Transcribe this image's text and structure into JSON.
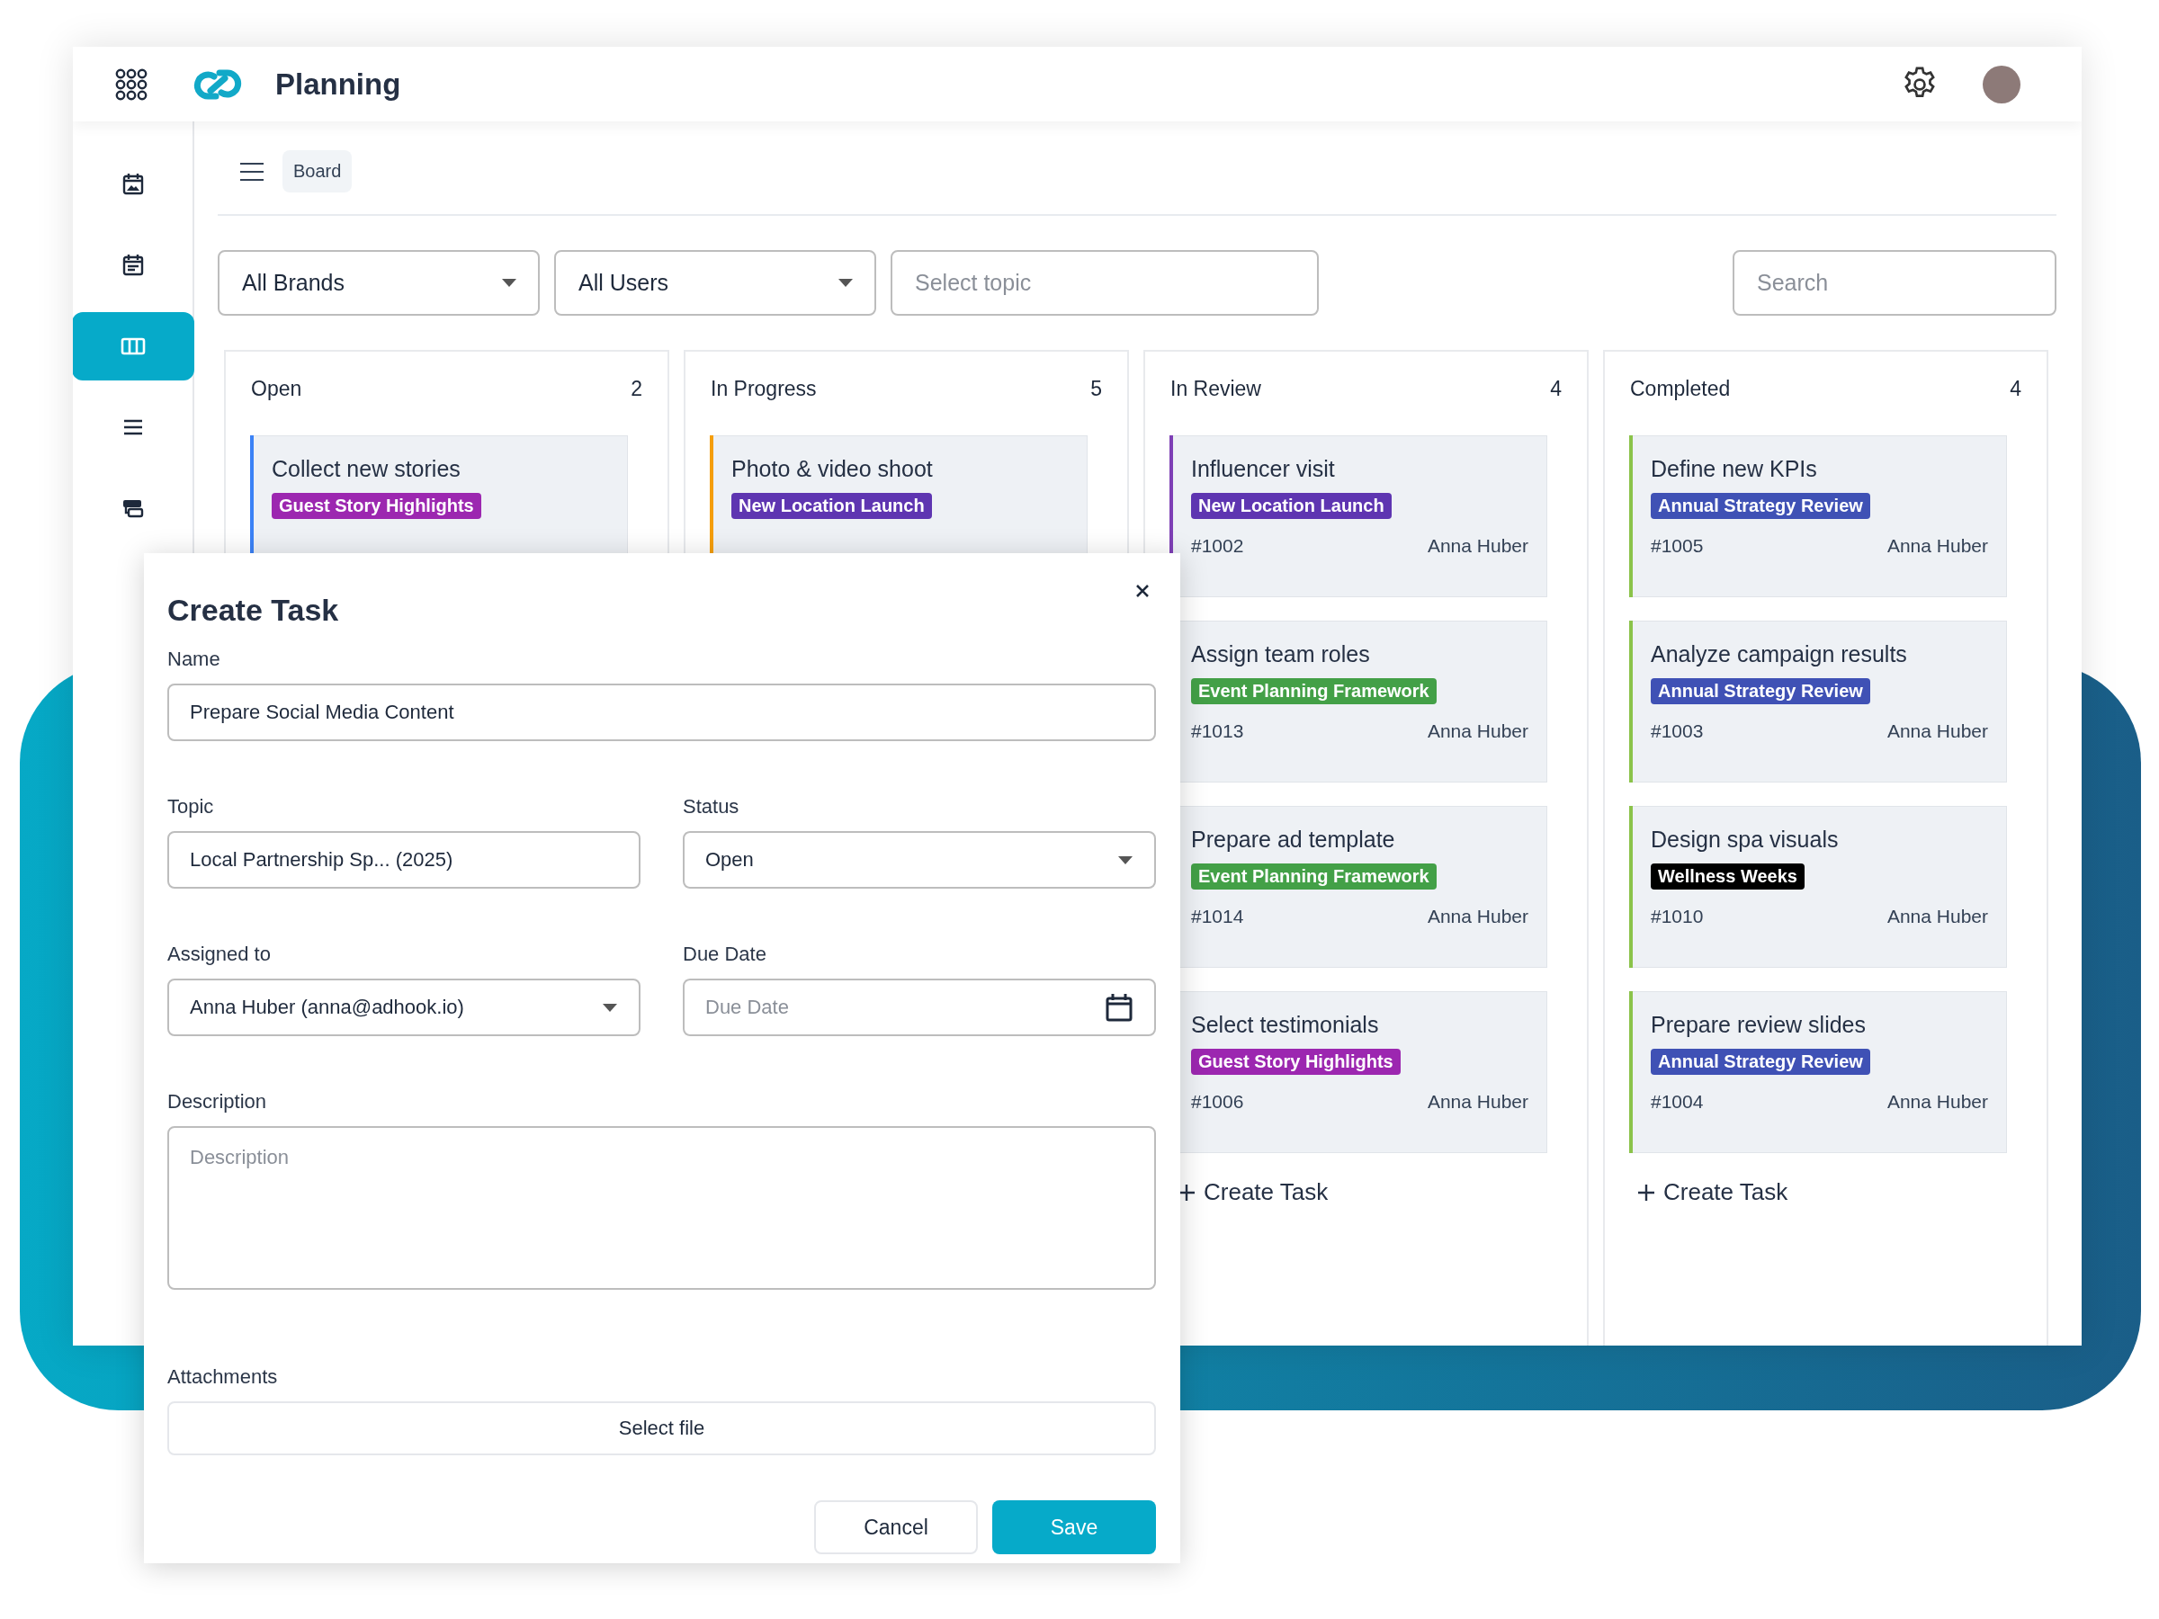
{
  "app_bar": {
    "title": "Planning"
  },
  "sidebar": {
    "items": [
      {
        "selected": false
      },
      {
        "selected": false
      },
      {
        "selected": true
      },
      {
        "selected": false
      },
      {
        "selected": false
      }
    ]
  },
  "breadcrumb": {
    "label": "Board"
  },
  "filters": [
    {
      "kind": "dropdown",
      "value": "All Brands"
    },
    {
      "kind": "dropdown",
      "value": "All Users"
    },
    {
      "kind": "field",
      "placeholder": "Select topic"
    }
  ],
  "search": {
    "placeholder": "Search"
  },
  "columns": [
    {
      "title": "Open",
      "count": "2",
      "color": "#3b82f6",
      "cards": [
        {
          "title": "Collect new stories",
          "tag": {
            "label": "Guest Story Highlights",
            "color": "#9c27b0"
          }
        }
      ]
    },
    {
      "title": "In Progress",
      "count": "5",
      "color": "#f59e0b",
      "cards": [
        {
          "title": "Photo & video shoot",
          "tag": {
            "label": "New Location Launch",
            "color": "#5e35b1"
          }
        }
      ]
    },
    {
      "title": "In Review",
      "count": "4",
      "color": "#7e3fb5",
      "create_label": "Create Task",
      "cards": [
        {
          "title": "Influencer visit",
          "tag": {
            "label": "New Location Launch",
            "color": "#5e35b1"
          },
          "id": "#1002",
          "assignee": "Anna Huber"
        },
        {
          "title": "Assign team roles",
          "tag": {
            "label": "Event Planning Framework",
            "color": "#43a047"
          },
          "id": "#1013",
          "assignee": "Anna Huber"
        },
        {
          "title": "Prepare ad template",
          "tag": {
            "label": "Event Planning Framework",
            "color": "#43a047"
          },
          "id": "#1014",
          "assignee": "Anna Huber"
        },
        {
          "title": "Select testimonials",
          "tag": {
            "label": "Guest Story Highlights",
            "color": "#9c27b0"
          },
          "id": "#1006",
          "assignee": "Anna Huber"
        }
      ]
    },
    {
      "title": "Completed",
      "count": "4",
      "color": "#8bc34a",
      "create_label": "Create Task",
      "cards": [
        {
          "title": "Define new KPIs",
          "tag": {
            "label": "Annual Strategy Review",
            "color": "#3f51b5"
          },
          "id": "#1005",
          "assignee": "Anna Huber"
        },
        {
          "title": "Analyze campaign results",
          "tag": {
            "label": "Annual Strategy Review",
            "color": "#3f51b5"
          },
          "id": "#1003",
          "assignee": "Anna Huber"
        },
        {
          "title": "Design spa visuals",
          "tag": {
            "label": "Wellness Weeks",
            "color": "#000000"
          },
          "id": "#1010",
          "assignee": "Anna Huber"
        },
        {
          "title": "Prepare review slides",
          "tag": {
            "label": "Annual Strategy Review",
            "color": "#3f51b5"
          },
          "id": "#1004",
          "assignee": "Anna Huber"
        }
      ]
    }
  ],
  "dialog": {
    "title": "Create Task",
    "name": {
      "label": "Name",
      "value": "Prepare Social Media Content"
    },
    "topic": {
      "label": "Topic",
      "value": "Local Partnership Sp... (2025)"
    },
    "status": {
      "label": "Status",
      "value": "Open"
    },
    "assigned_to": {
      "label": "Assigned to",
      "value": "Anna Huber (anna@adhook.io)"
    },
    "due_date": {
      "label": "Due Date",
      "placeholder": "Due Date"
    },
    "description": {
      "label": "Description",
      "placeholder": "Description"
    },
    "attachments": {
      "label": "Attachments",
      "button": "Select file"
    },
    "buttons": [
      {
        "kind": "secondary",
        "label": "Cancel"
      },
      {
        "kind": "primary",
        "label": "Save"
      }
    ]
  }
}
